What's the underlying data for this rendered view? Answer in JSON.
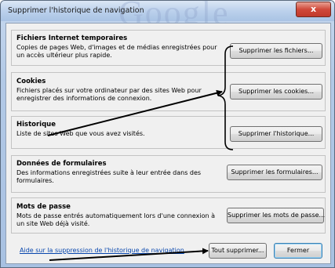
{
  "window": {
    "title": "Supprimer l'historique de navigation",
    "watermark": "Google",
    "close_label": "x"
  },
  "sections": [
    {
      "title": "Fichiers Internet temporaires",
      "description": "Copies de pages Web, d'images et de médias enregistrées pour un accès ultérieur plus rapide.",
      "button": "Supprimer les fichiers..."
    },
    {
      "title": "Cookies",
      "description": "Fichiers placés sur votre ordinateur par des sites Web pour enregistrer des informations de connexion.",
      "button": "Supprimer les cookies..."
    },
    {
      "title": "Historique",
      "description": "Liste de sites Web que vous avez visités.",
      "button": "Supprimer l'historique..."
    },
    {
      "title": "Données de formulaires",
      "description": "Des informations enregistrées suite à leur entrée dans des formulaires.",
      "button": "Supprimer les formulaires..."
    },
    {
      "title": "Mots de passe",
      "description": "Mots de passe entrés automatiquement lors d'une connexion à un site Web déjà visité.",
      "button": "Supprimer les mots de passe..."
    }
  ],
  "footer": {
    "help_link": "Aide sur la suppression de l'historique de navigation",
    "delete_all": "Tout supprimer...",
    "close": "Fermer"
  }
}
